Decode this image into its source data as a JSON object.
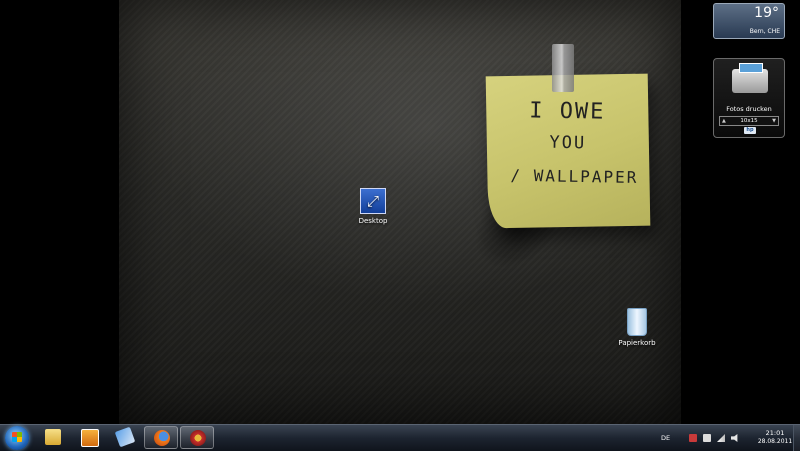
{
  "sticky_note": {
    "line1": "I OWE",
    "line2": "YOU",
    "line3": "/ WALLPAPER"
  },
  "desktop_icons": [
    {
      "label": "Desktop",
      "icon": "desktop-shortcut-icon"
    },
    {
      "label": "Papierkorb",
      "icon": "recycle-bin-icon"
    }
  ],
  "weather_gadget": {
    "temperature": "19°",
    "location": "Bern, CHE"
  },
  "photo_gadget": {
    "title": "Fotos drucken",
    "size": "10x15",
    "prev_arrow": "▲",
    "next_arrow": "▼",
    "brand": "hp"
  },
  "taskbar": {
    "start_icon": "windows-logo-icon",
    "pinned": [
      {
        "name": "explorer",
        "icon": "folder-icon"
      },
      {
        "name": "media-player",
        "icon": "play-icon"
      },
      {
        "name": "app",
        "icon": "app-icon"
      },
      {
        "name": "firefox",
        "icon": "firefox-icon",
        "active": true
      },
      {
        "name": "app2",
        "icon": "app-icon",
        "active": true
      }
    ],
    "tray": {
      "language": "DE",
      "time": "21:01",
      "date": "28.08.2011"
    }
  },
  "colors": {
    "note": "#d6d27e",
    "taskbar": "#1d2430"
  }
}
